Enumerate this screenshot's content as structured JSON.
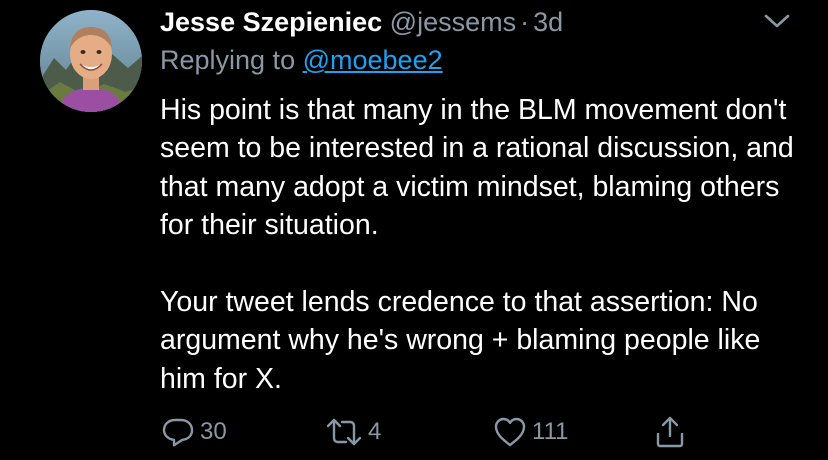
{
  "tweet": {
    "author_name": "Jesse Szepieniec",
    "author_handle": "@jessems",
    "separator": "·",
    "time": "3d",
    "replying_prefix": "Replying to",
    "replying_to": "@moebee2",
    "paragraphs": [
      "His point is that many in the BLM movement don't seem to be interested in a rational discussion, and that many adopt a victim mindset, blaming others for their situation.",
      "Your tweet lends credence to that assertion: No argument why he's wrong + blaming people like him for X."
    ]
  },
  "actions": {
    "replies": "30",
    "retweets": "4",
    "likes": "111"
  },
  "icons": {
    "menu": "chevron-down-icon",
    "reply": "reply-icon",
    "retweet": "retweet-icon",
    "like": "heart-icon",
    "share": "share-icon"
  },
  "colors": {
    "background": "#000000",
    "text": "#ffffff",
    "muted": "#8899a6",
    "link": "#1da1f2"
  }
}
